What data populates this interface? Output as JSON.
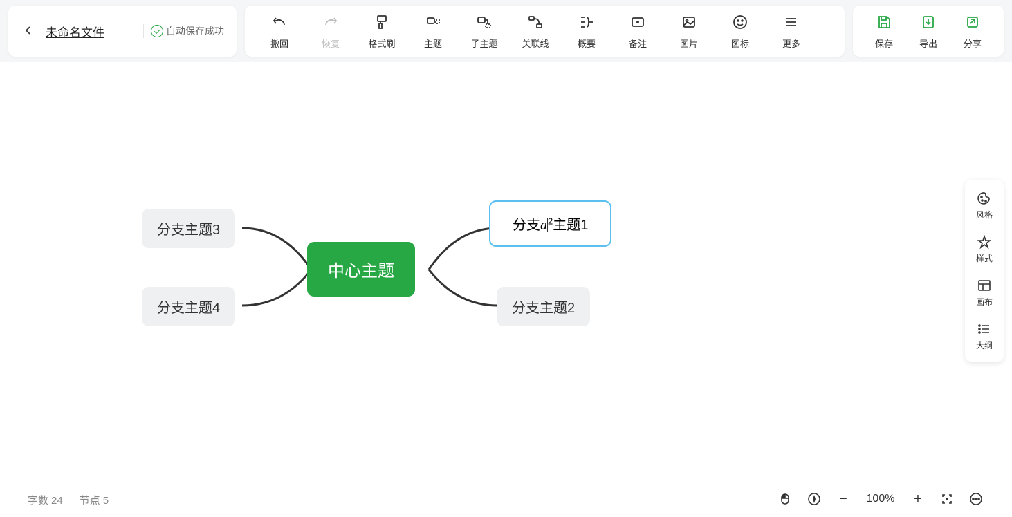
{
  "header": {
    "file_title": "未命名文件",
    "autosave_status": "自动保存成功"
  },
  "toolbar": {
    "undo": "撤回",
    "redo": "恢复",
    "format_painter": "格式刷",
    "topic": "主题",
    "subtopic": "子主题",
    "relation": "关联线",
    "summary": "概要",
    "note": "备注",
    "image": "图片",
    "icon": "图标",
    "more": "更多"
  },
  "actions": {
    "save": "保存",
    "export": "导出",
    "share": "分享"
  },
  "side": {
    "style_theme": "风格",
    "format": "样式",
    "canvas": "画布",
    "outline": "大纲"
  },
  "mindmap": {
    "center": "中心主题",
    "branch1_prefix": "分支",
    "branch1_mathvar": "a",
    "branch1_exp": "2",
    "branch1_suffix": "主题1",
    "branch2": "分支主题2",
    "branch3": "分支主题3",
    "branch4": "分支主题4"
  },
  "status": {
    "wordcount_label": "字数",
    "wordcount_value": "24",
    "nodecount_label": "节点",
    "nodecount_value": "5"
  },
  "zoom": {
    "level": "100%"
  }
}
